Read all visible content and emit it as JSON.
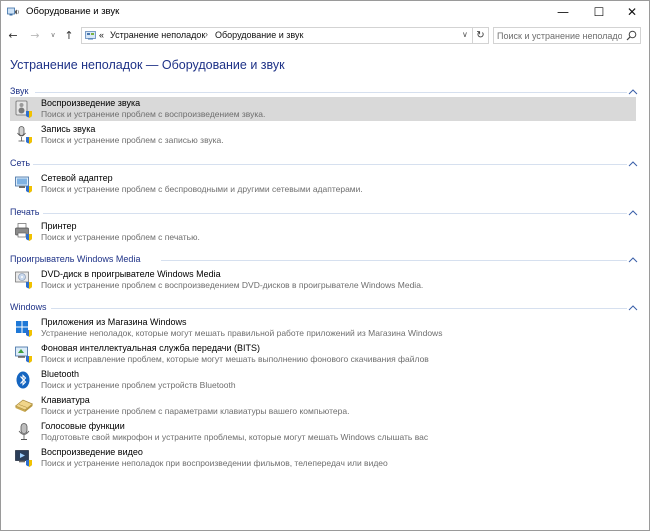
{
  "window": {
    "title": "Оборудование и звук",
    "controls": {
      "minimize": "—",
      "maximize": "☐",
      "close": "✕"
    }
  },
  "nav": {
    "back": "←",
    "forward": "→",
    "history": "∨",
    "up": "↑",
    "breadcrumb_prefix": "«",
    "crumbs": [
      "Устранение неполадок",
      "Оборудование и звук"
    ],
    "separator": "›",
    "dropdown": "∨",
    "refresh": "↻",
    "search_placeholder": "Поиск и устранение неполадок"
  },
  "page": {
    "title": "Устранение неполадок — Оборудование и звук"
  },
  "groups": [
    {
      "title": "Звук",
      "items": [
        {
          "name": "Воспроизведение звука",
          "desc": "Поиск и устранение проблем с воспроизведением звука.",
          "icon": "speaker-troubleshoot-icon",
          "selected": true
        },
        {
          "name": "Запись звука",
          "desc": "Поиск и устранение проблем с записью звука.",
          "icon": "microphone-troubleshoot-icon",
          "selected": false
        }
      ]
    },
    {
      "title": "Сеть",
      "items": [
        {
          "name": "Сетевой адаптер",
          "desc": "Поиск и устранение проблем с беспроводными и другими сетевыми адаптерами.",
          "icon": "network-adapter-icon",
          "selected": false
        }
      ]
    },
    {
      "title": "Печать",
      "items": [
        {
          "name": "Принтер",
          "desc": "Поиск и устранение проблем с печатью.",
          "icon": "printer-icon",
          "selected": false
        }
      ]
    },
    {
      "title": "Проигрыватель Windows Media",
      "items": [
        {
          "name": "DVD-диск в проигрывателе Windows Media",
          "desc": "Поиск и устранение проблем с воспроизведением DVD-дисков в проигрывателе Windows Media.",
          "icon": "dvd-disc-icon",
          "selected": false
        }
      ]
    },
    {
      "title": "Windows",
      "items": [
        {
          "name": "Приложения из Магазина Windows",
          "desc": "Устранение неполадок, которые могут мешать правильной работе приложений из Магазина Windows",
          "icon": "windows-store-icon",
          "selected": false
        },
        {
          "name": "Фоновая интеллектуальная служба передачи (BITS)",
          "desc": "Поиск и исправление проблем, которые могут мешать выполнению фонового скачивания файлов",
          "icon": "bits-transfer-icon",
          "selected": false
        },
        {
          "name": "Bluetooth",
          "desc": "Поиск и устранение проблем устройств Bluetooth",
          "icon": "bluetooth-icon",
          "selected": false
        },
        {
          "name": "Клавиатура",
          "desc": "Поиск и устранение проблем с параметрами клавиатуры вашего компьютера.",
          "icon": "keyboard-icon",
          "selected": false
        },
        {
          "name": "Голосовые функции",
          "desc": "Подготовьте свой микрофон и устраните проблемы, которые могут мешать Windows слышать вас",
          "icon": "speech-microphone-icon",
          "selected": false
        },
        {
          "name": "Воспроизведение видео",
          "desc": "Поиск и устранение неполадок при воспроизведении фильмов, телепередач или видео",
          "icon": "video-playback-icon",
          "selected": false
        }
      ]
    }
  ]
}
